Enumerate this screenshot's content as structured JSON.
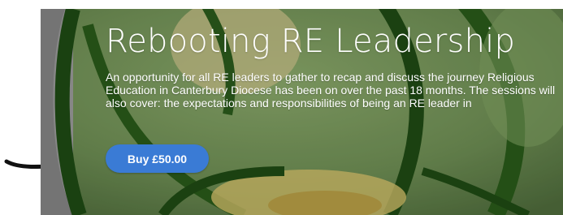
{
  "hero": {
    "title": "Rebooting RE Leadership",
    "description": "An opportunity for all RE leaders to gather to recap and discuss the journey Religious Education in Canterbury Diocese has been on over the past 18 months. The sessions will also cover: the expectations and responsibilities of being an RE leader in",
    "buy_label": "Buy £50.00",
    "buy_color": "#3a7bd5"
  },
  "annotation": {
    "icon": "arrow-right-icon"
  }
}
